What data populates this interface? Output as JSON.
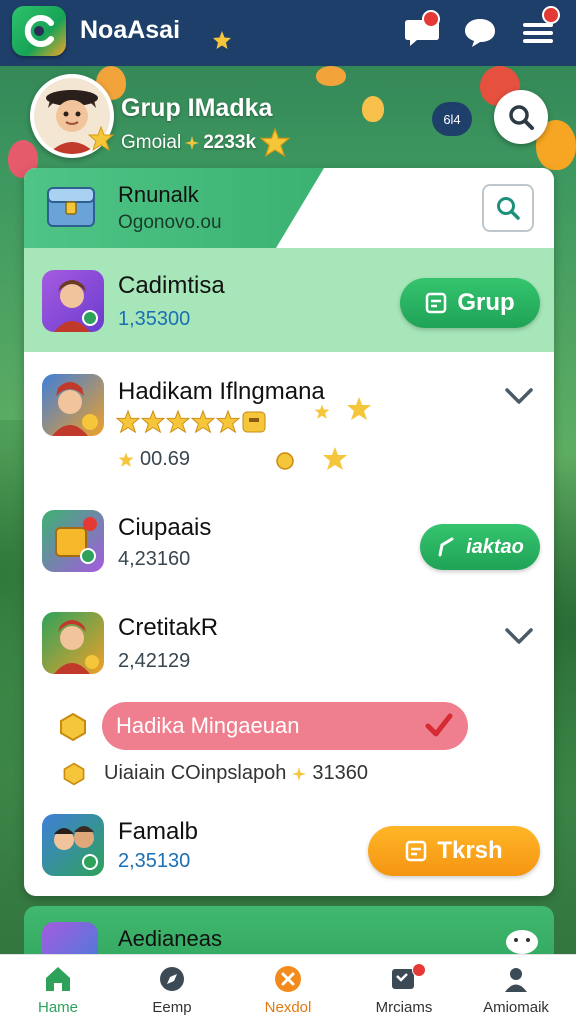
{
  "app": {
    "name": "NoaAsai"
  },
  "profile": {
    "name": "Grup IMadka",
    "sub_label": "Gmoial",
    "points": "2233k",
    "count_pill": "6l4"
  },
  "card": {
    "title": "Rnunalk",
    "subtitle": "Ogonovo.ou",
    "rows": [
      {
        "title": "Cadimtisa",
        "value": "1,35300",
        "button": "Grup"
      },
      {
        "title": "Hadikam Iflngmana",
        "rating_value": "00.69"
      },
      {
        "title": "Ciupaais",
        "value": "4,23160",
        "button": "iaktao"
      },
      {
        "title": "CretitakR",
        "value": "2,42129"
      },
      {
        "title": "Famalb",
        "value": "2,35130",
        "button": "Tkrsh"
      }
    ],
    "promo": {
      "label": "Hadika Mingaeuan"
    },
    "coin_line": {
      "label": "Uiaiain COinpslapoh",
      "points": "31360"
    }
  },
  "card2": {
    "title": "Aedianeas"
  },
  "bottom_nav": [
    {
      "label": "Hame",
      "icon": "home-icon"
    },
    {
      "label": "Eemp",
      "icon": "compass-icon"
    },
    {
      "label": "Nexdol",
      "icon": "cancel-circle-icon"
    },
    {
      "label": "Mrciams",
      "icon": "messages-icon"
    },
    {
      "label": "Amiomaik",
      "icon": "profile-icon"
    }
  ],
  "colors": {
    "topbar": "#1f3f6b",
    "accent_green": "#2ea25b",
    "accent_orange": "#f59512",
    "promo_pink": "#ef7f8e",
    "badge_red": "#e53935"
  }
}
